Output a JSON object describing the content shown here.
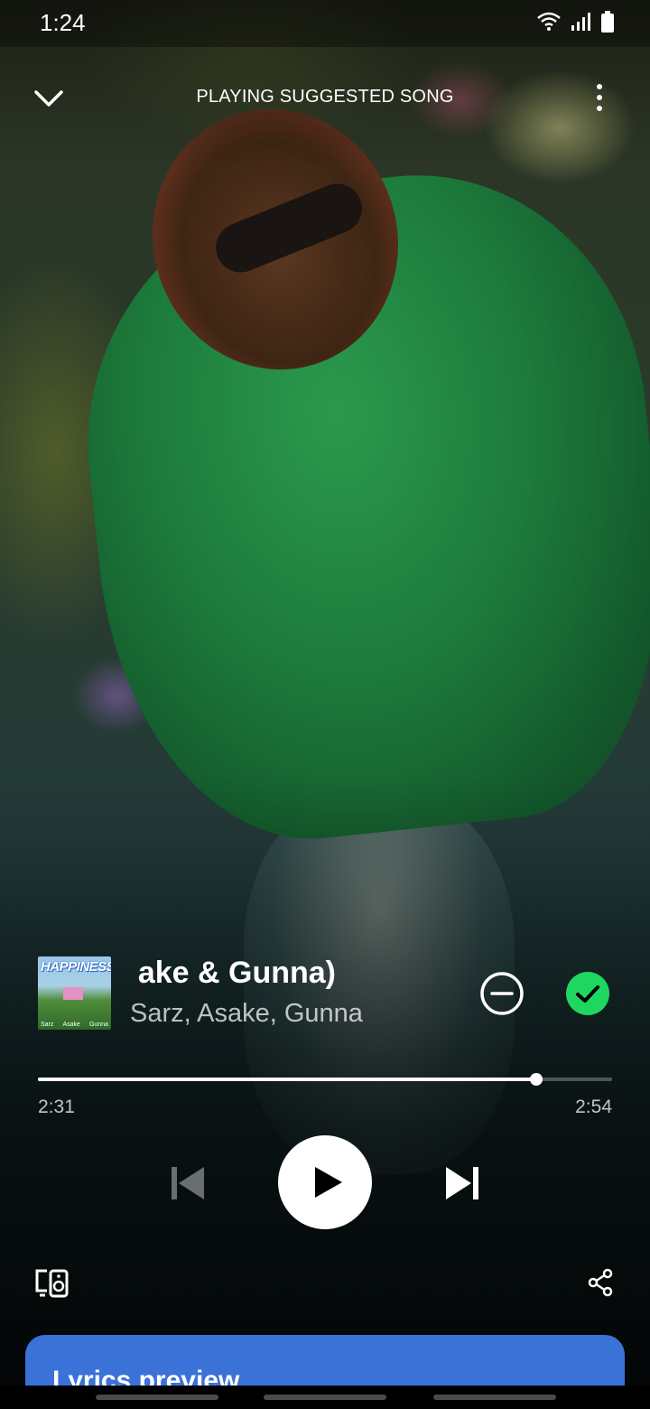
{
  "status_bar": {
    "time": "1:24",
    "icons": [
      "wifi-icon",
      "signal-icon",
      "battery-icon"
    ]
  },
  "header": {
    "title": "PLAYING SUGGESTED SONG",
    "collapse_icon": "chevron-down-icon",
    "more_icon": "more-vertical-icon"
  },
  "track": {
    "title": "Happiness (feat. Asake & Gunna)",
    "visible_title": "ake & Gunna)",
    "artists": "Sarz, Asake, Gunna",
    "album_art": {
      "title": "HAPPINESS",
      "credits": [
        "Sarz",
        "Asake",
        "Gunna"
      ]
    }
  },
  "progress": {
    "elapsed": "2:31",
    "total": "2:54",
    "fraction": 0.868
  },
  "controls": {
    "previous_icon": "skip-previous-icon",
    "play_icon": "play-icon",
    "next_icon": "skip-next-icon",
    "hide_icon": "remove-circle-icon",
    "added_icon": "check-circle-icon"
  },
  "tools": {
    "devices_icon": "connect-devices-icon",
    "share_icon": "share-icon"
  },
  "lyrics": {
    "title": "Lyrics preview"
  },
  "colors": {
    "accent_green": "#1ed760",
    "lyrics_card": "#3a72d8"
  }
}
